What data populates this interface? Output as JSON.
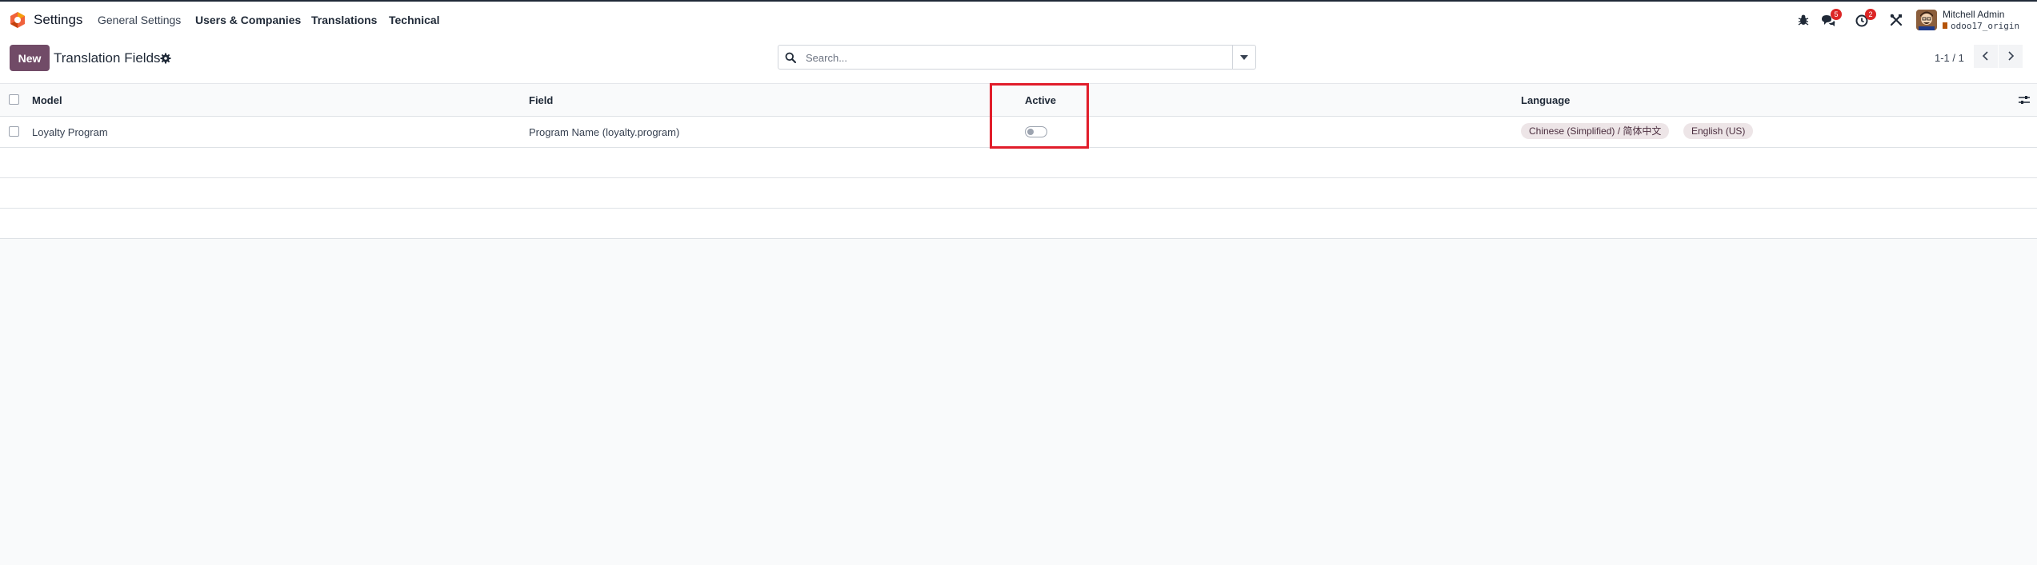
{
  "app": {
    "name": "Settings",
    "menu": [
      "General Settings",
      "Users & Companies",
      "Translations",
      "Technical"
    ]
  },
  "systray": {
    "messages_count": "5",
    "activities_count": "2",
    "user_name": "Mitchell Admin",
    "database": "odoo17_origin",
    "icons": [
      "bug-icon",
      "chat-icon",
      "clock-icon",
      "tools-icon"
    ]
  },
  "control_panel": {
    "new_label": "New",
    "title": "Translation Fields",
    "search_placeholder": "Search...",
    "pager_value": "1-1 / 1"
  },
  "list": {
    "columns": [
      "Model",
      "Field",
      "Active",
      "Language"
    ],
    "rows": [
      {
        "model": "Loyalty Program",
        "field": "Program Name (loyalty.program)",
        "active": false,
        "languages": [
          "Chinese (Simplified) / 简体中文",
          "English (US)"
        ]
      }
    ],
    "empty_rows": 3
  },
  "colors": {
    "brand": "#714b67",
    "highlight": "#e11d2a",
    "badge": "#dc2626"
  }
}
